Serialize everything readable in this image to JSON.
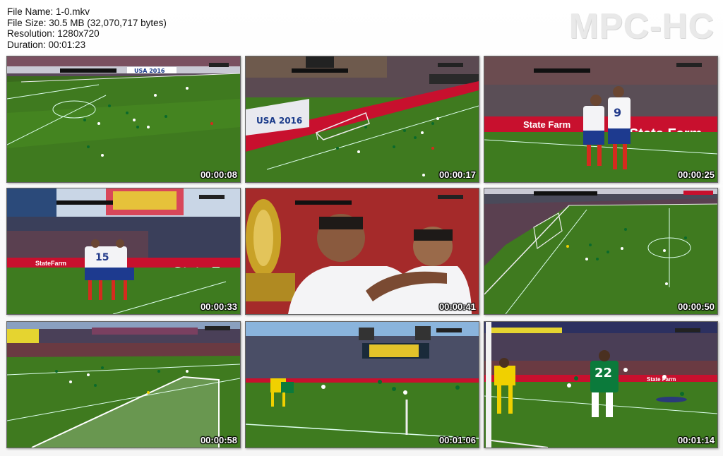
{
  "info": {
    "file_name": "File Name: 1-0.mkv",
    "file_size": "File Size: 30.5 MB (32,070,717 bytes)",
    "resolution": "Resolution: 1280x720",
    "duration": "Duration: 00:01:23"
  },
  "logo_text": "MPC-HC",
  "thumbnails": [
    {
      "timestamp": "00:00:08",
      "ad_text": "USA 2016"
    },
    {
      "timestamp": "00:00:17",
      "ad_text": "USA 2016"
    },
    {
      "timestamp": "00:00:25",
      "ad_text": "State Farm",
      "jersey": "9"
    },
    {
      "timestamp": "00:00:33",
      "ad_text": "State Farm",
      "jersey": "15"
    },
    {
      "timestamp": "00:00:41"
    },
    {
      "timestamp": "00:00:50"
    },
    {
      "timestamp": "00:00:58"
    },
    {
      "timestamp": "00:01:06"
    },
    {
      "timestamp": "00:01:14",
      "ad_text": "State Farm",
      "jersey": "22"
    }
  ],
  "colors": {
    "pitch": "#3f7a1f",
    "pitch_light": "#4e8c25",
    "ad_board_red": "#c8102e",
    "chile_red": "#d52b1e",
    "bolivia_green": "#0b7a3b"
  }
}
